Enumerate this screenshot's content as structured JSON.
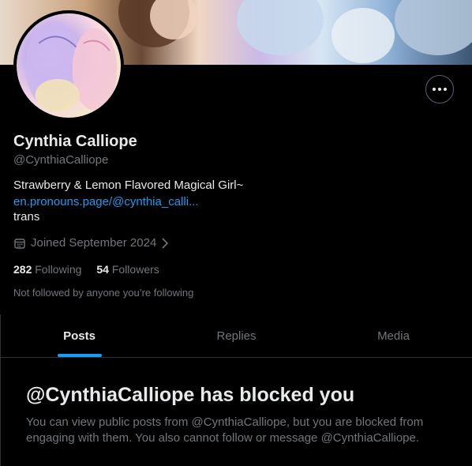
{
  "profile": {
    "name": "Cynthia Calliope",
    "handle": "@CynthiaCalliope",
    "bio_line": "Strawberry & Lemon Flavored Magical Girl~",
    "link": "en.pronouns.page/@cynthia_calli...",
    "bio_line2": "trans",
    "joined": "Joined September 2024",
    "following_count": "282",
    "following_label": "Following",
    "followers_count": "54",
    "followers_label": "Followers",
    "followed_by": "Not followed by anyone you’re following"
  },
  "tabs": [
    {
      "label": "Posts"
    },
    {
      "label": "Replies"
    },
    {
      "label": "Media"
    }
  ],
  "blocked": {
    "title": "@CynthiaCalliope has blocked you",
    "description": "You can view public posts from @CynthiaCalliope, but you are blocked from engaging with them. You also cannot follow or message @CynthiaCalliope."
  },
  "icons": {
    "more": "more-horizontal-icon",
    "calendar": "calendar-icon",
    "chevron": "chevron-right-icon"
  },
  "colors": {
    "accent": "#1d9bf0",
    "secondary_text": "#71767b",
    "primary_text": "#e7e9ea",
    "background": "#000000"
  }
}
